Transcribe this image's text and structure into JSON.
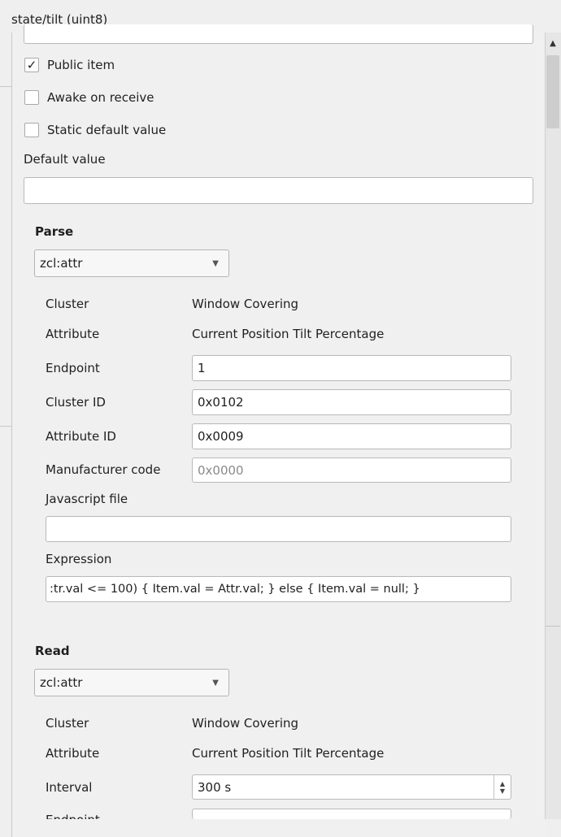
{
  "title": "state/tilt  (uint8)",
  "public_item": {
    "label": "Public item",
    "checked": "✓"
  },
  "awake_on_receive": {
    "label": "Awake on receive"
  },
  "static_default": {
    "label": "Static default value"
  },
  "default_value": {
    "label": "Default value",
    "value": ""
  },
  "parse": {
    "heading": "Parse",
    "function": "zcl:attr",
    "cluster_label": "Cluster",
    "cluster_value": "Window Covering",
    "attribute_label": "Attribute",
    "attribute_value": "Current Position Tilt Percentage",
    "endpoint_label": "Endpoint",
    "endpoint_value": "1",
    "cluster_id_label": "Cluster ID",
    "cluster_id_value": "0x0102",
    "attribute_id_label": "Attribute ID",
    "attribute_id_value": "0x0009",
    "mfr_label": "Manufacturer code",
    "mfr_placeholder": "0x0000",
    "js_label": "Javascript file",
    "js_value": "",
    "expr_label": "Expression",
    "expr_value": ":tr.val <= 100) { Item.val = Attr.val; } else { Item.val = null; }"
  },
  "read": {
    "heading": "Read",
    "function": "zcl:attr",
    "cluster_label": "Cluster",
    "cluster_value": "Window Covering",
    "attribute_label": "Attribute",
    "attribute_value": "Current Position Tilt Percentage",
    "interval_label": "Interval",
    "interval_value": "300 s",
    "endpoint_label": "Endpoint"
  },
  "scroll": {
    "up": "▲"
  }
}
